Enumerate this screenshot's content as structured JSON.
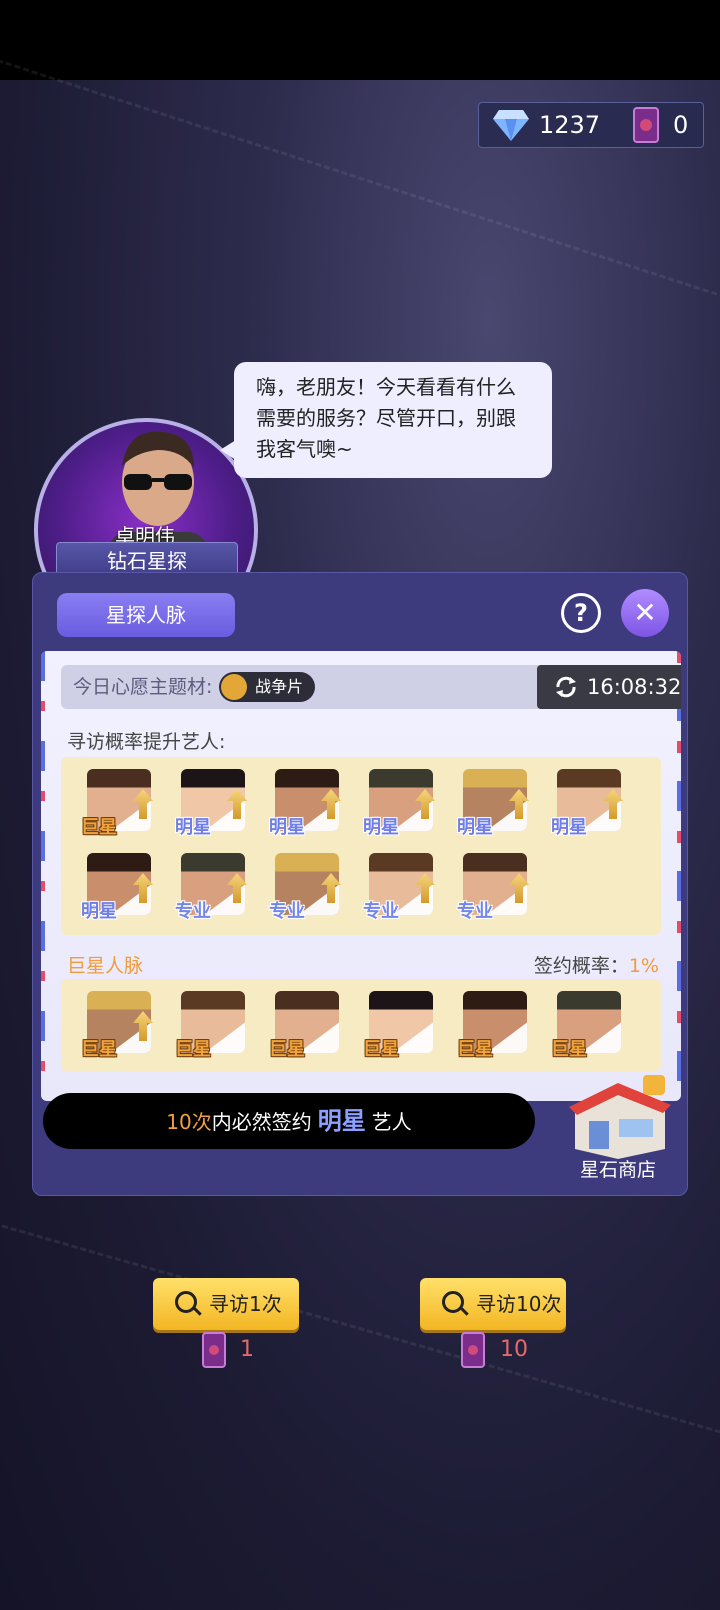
{
  "currency": {
    "gem_icon": "diamond-icon",
    "gems": "1237",
    "card_icon": "scout-card-icon",
    "cards": "0"
  },
  "scout": {
    "name": "卓明伟",
    "rank": "钻石星探",
    "dialog": "嗨，老朋友！今天看看有什么需要的服务？尽管开口，别跟我客气噢~"
  },
  "panel": {
    "tab": "星探人脉",
    "help": "?",
    "close": "✕",
    "theme_label": "今日心愿主题材:",
    "theme_value": "战争片",
    "timer": "16:08:32",
    "boost_title": "寻访概率提升艺人:",
    "boost_row1": [
      "巨星",
      "明星",
      "明星",
      "明星",
      "明星",
      "明星"
    ],
    "boost_row2": [
      "明星",
      "专业",
      "专业",
      "专业",
      "专业"
    ],
    "giant_title": "巨星人脉",
    "sign_rate_label": "签约概率：",
    "sign_rate_value": "1%",
    "giant_row": [
      "巨星",
      "巨星",
      "巨星",
      "巨星",
      "巨星",
      "巨星"
    ],
    "guarantee_count": "10次",
    "guarantee_mid": "内必然签约",
    "guarantee_rank": "明星",
    "guarantee_end": "艺人",
    "shop_label": "星石商店"
  },
  "actions": [
    {
      "label": "寻访1次",
      "cost": "1"
    },
    {
      "label": "寻访10次",
      "cost": "10"
    }
  ],
  "colors": {
    "accent": "#6a5ce0",
    "gold": "#f3b623",
    "giant": "#f2a33a",
    "star": "#6f7eea",
    "background": "#2d2b4c"
  }
}
